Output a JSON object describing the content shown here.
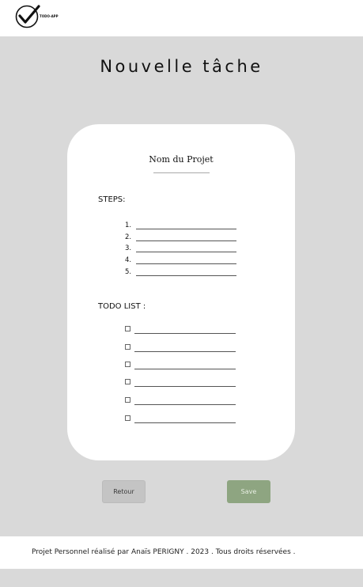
{
  "header": {
    "logo_text": "TODO-APP",
    "logo_icon": "checkmark-circle-icon"
  },
  "page": {
    "title": "Nouvelle tâche"
  },
  "card": {
    "project_name": "Nom du Projet",
    "steps_label": "STEPS:",
    "steps": [
      "1.",
      "2.",
      "3.",
      "4.",
      "5."
    ],
    "todo_label": "TODO LIST :",
    "todo_count": 6
  },
  "buttons": {
    "back_label": "Retour",
    "save_label": "Save"
  },
  "footer": {
    "text": "Projet Personnel réalisé par Anaïs PERIGNY . 2023 . Tous droits réservées ."
  },
  "colors": {
    "background": "#d9d9d9",
    "save_button": "#8ea581",
    "back_button": "#c4c4c4"
  }
}
